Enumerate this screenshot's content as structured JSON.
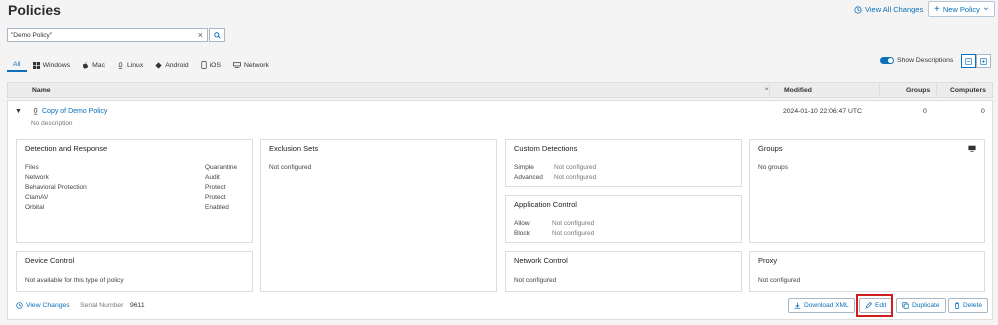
{
  "page": {
    "title": "Policies"
  },
  "header": {
    "view_all_changes": "View All Changes",
    "new_policy": "New Policy"
  },
  "search": {
    "value": "\"Demo Policy\"",
    "placeholder": ""
  },
  "tabs": [
    {
      "label": "All",
      "icon": "none"
    },
    {
      "label": "Windows",
      "icon": "windows-icon"
    },
    {
      "label": "Mac",
      "icon": "apple-icon"
    },
    {
      "label": "Linux",
      "icon": "linux-icon"
    },
    {
      "label": "Android",
      "icon": "android-icon"
    },
    {
      "label": "iOS",
      "icon": "phone-icon"
    },
    {
      "label": "Network",
      "icon": "network-icon"
    }
  ],
  "show_descriptions": {
    "label": "Show Descriptions",
    "enabled": true
  },
  "table": {
    "columns": {
      "name": "Name",
      "modified": "Modified",
      "groups": "Groups",
      "computers": "Computers"
    }
  },
  "policy": {
    "name": "Copy of Demo Policy",
    "description": "No description",
    "modified": "2024-01-10 22:06:47 UTC",
    "groups": "0",
    "computers": "0",
    "serial_label": "Serial Number",
    "serial": "9611",
    "view_changes": "View Changes"
  },
  "cards": {
    "detection": {
      "title": "Detection and Response",
      "items": [
        {
          "k": "Files",
          "v": "Quarantine"
        },
        {
          "k": "Network",
          "v": "Audit"
        },
        {
          "k": "Behavioral Protection",
          "v": "Protect"
        },
        {
          "k": "ClamAV",
          "v": "Protect"
        },
        {
          "k": "Orbital",
          "v": "Enabled"
        }
      ]
    },
    "exclusion": {
      "title": "Exclusion Sets",
      "text": "Not configured"
    },
    "custom": {
      "title": "Custom Detections",
      "items": [
        {
          "k": "Simple",
          "v": "Not configured"
        },
        {
          "k": "Advanced",
          "v": "Not configured"
        }
      ]
    },
    "groups": {
      "title": "Groups",
      "text": "No groups"
    },
    "appcontrol": {
      "title": "Application Control",
      "items": [
        {
          "k": "Allow",
          "v": "Not configured"
        },
        {
          "k": "Block",
          "v": "Not configured"
        }
      ]
    },
    "device": {
      "title": "Device Control",
      "text": "Not available for this type of policy"
    },
    "network": {
      "title": "Network Control",
      "text": "Not configured"
    },
    "proxy": {
      "title": "Proxy",
      "text": "Not configured"
    }
  },
  "actions": {
    "download": "Download XML",
    "edit": "Edit",
    "duplicate": "Duplicate",
    "delete": "Delete"
  },
  "colors": {
    "accent": "#0d6fb8",
    "highlight": "#d01d1d"
  }
}
